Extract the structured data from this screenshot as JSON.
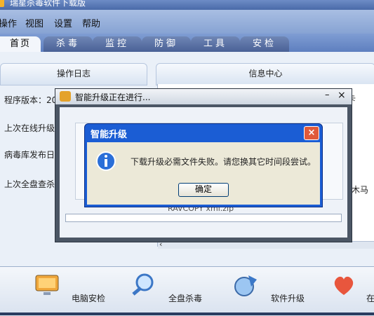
{
  "window": {
    "title": "瑞星杀毒软件下载版"
  },
  "menu": [
    "操作",
    "视图",
    "设置",
    "帮助"
  ],
  "tabs": [
    "首页",
    "杀毒",
    "监控",
    "防御",
    "工具",
    "安检"
  ],
  "main": {
    "left_panel_title": "操作日志",
    "right_panel_title": "信息中心",
    "rows": [
      "程序版本：20",
      "上次在线升级",
      "病毒库发布日",
      "上次全盘查杀"
    ],
    "right_fragment": "卡",
    "right_fragment2": "木马"
  },
  "progress_dialog": {
    "title": "智能升级正在进行...",
    "file_label": "RAVCOPY  xml.zip",
    "controls": [
      "–",
      "×"
    ]
  },
  "modal": {
    "title": "智能升级",
    "message": "下载升级必需文件失败。请您换其它时间段尝试。",
    "ok_label": "确定",
    "close_label": "×"
  },
  "toolbar": [
    "电脑安检",
    "全盘杀毒",
    "软件升级",
    "在"
  ]
}
